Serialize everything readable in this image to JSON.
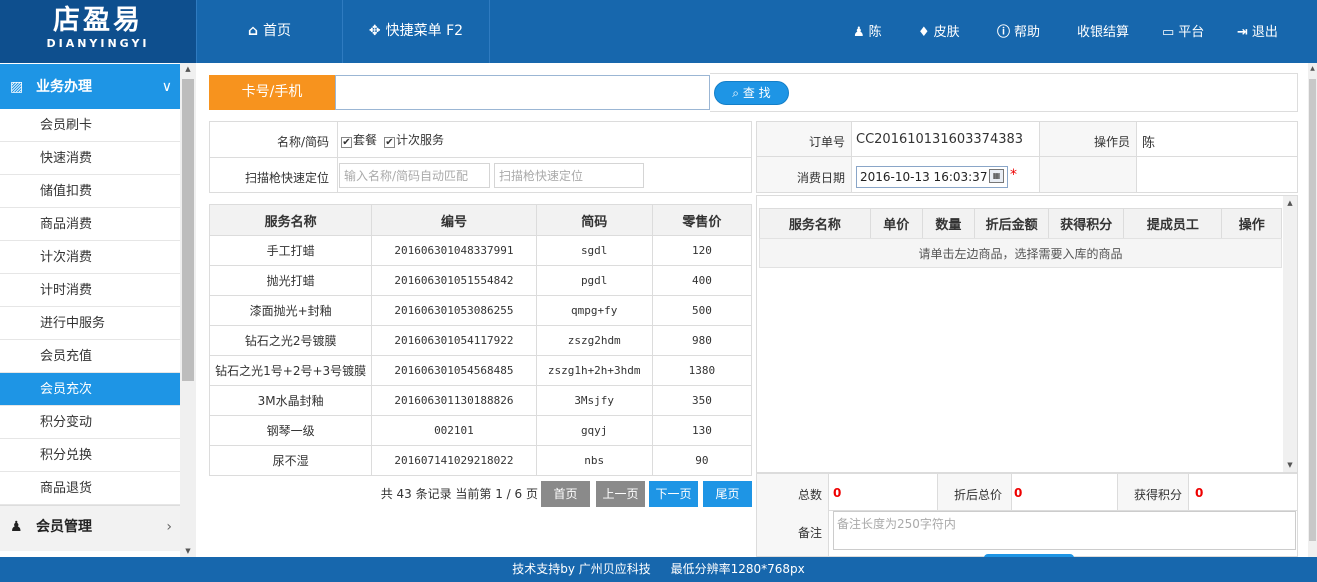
{
  "logo": {
    "line1": "店盈易",
    "line2": "DIANYINGYI"
  },
  "topnav": {
    "home": "首页",
    "quick_menu": "快捷菜单 F2"
  },
  "topright": {
    "user": "陈",
    "skin": "皮肤",
    "help": "帮助",
    "checkout": "收银结算",
    "platform": "平台",
    "logout": "退出"
  },
  "sidebar": {
    "section1": "业务办理",
    "items": [
      "会员刷卡",
      "快速消费",
      "储值扣费",
      "商品消费",
      "计次消费",
      "计时消费",
      "进行中服务",
      "会员充值",
      "会员充次",
      "积分变动",
      "积分兑换",
      "商品退货"
    ],
    "active_index": 8,
    "section2": "会员管理"
  },
  "card": {
    "label": "卡号/手机",
    "value": "",
    "search_button": "查 找"
  },
  "filters": {
    "name_label": "名称/简码",
    "opt_package": "套餐",
    "opt_times": "计次服务",
    "opt_checked": "✔",
    "scan_label": "扫描枪快速定位",
    "name_placeholder": "输入名称/简码自动匹配",
    "scan_placeholder": "扫描枪快速定位"
  },
  "services": {
    "headers": [
      "服务名称",
      "编号",
      "简码",
      "零售价"
    ],
    "rows": [
      [
        "手工打蜡",
        "201606301048337991",
        "sgdl",
        "120"
      ],
      [
        "抛光打蜡",
        "201606301051554842",
        "pgdl",
        "400"
      ],
      [
        "漆面抛光+封釉",
        "201606301053086255",
        "qmpg+fy",
        "500"
      ],
      [
        "钻石之光2号镀膜",
        "201606301054117922",
        "zszg2hdm",
        "980"
      ],
      [
        "钻石之光1号+2号+3号镀膜",
        "201606301054568485",
        "zszg1h+2h+3hdm",
        "1380"
      ],
      [
        "3M水晶封釉",
        "201606301130188826",
        "3Msjfy",
        "350"
      ],
      [
        "钢琴一级",
        "002101",
        "gqyj",
        "130"
      ],
      [
        "尿不湿",
        "201607141029218022",
        "nbs",
        "90"
      ]
    ]
  },
  "pager": {
    "info": "共 43 条记录 当前第 1 / 6 页",
    "first": "首页",
    "prev": "上一页",
    "next": "下一页",
    "last": "尾页"
  },
  "order": {
    "no_label": "订单号",
    "no_value": "CC201610131603374383",
    "operator_label": "操作员",
    "operator_value": "陈",
    "date_label": "消费日期",
    "date_value": "2016-10-13 16:03:37",
    "required_mark": "*"
  },
  "cart": {
    "headers": [
      "服务名称",
      "单价",
      "数量",
      "折后金额",
      "获得积分",
      "提成员工",
      "操作"
    ],
    "empty_text": "请单击左边商品，选择需要入库的商品"
  },
  "summary": {
    "total_label": "总数",
    "total_value": "0",
    "discount_label": "折后总价",
    "discount_value": "0",
    "points_label": "获得积分",
    "points_value": "0",
    "remark_label": "备注",
    "remark_placeholder": "备注长度为250字符内"
  },
  "footer": {
    "support": "技术支持by 广州贝应科技",
    "resolution": "最低分辨率1280*768px"
  },
  "icons": {
    "home": "house-icon",
    "move": "move-icon",
    "user": "user-icon",
    "skin": "shirt-icon",
    "help": "help-icon",
    "monitor": "monitor-icon",
    "logout": "logout-icon",
    "search": "search-icon",
    "calendar": "calendar-icon"
  },
  "colors": {
    "header": "#1767ad",
    "logo_bg": "#0e4f8e",
    "accent": "#1e95e5",
    "orange": "#f7931e",
    "page_btn": "#8a8a8a",
    "required": "#ee0000"
  }
}
